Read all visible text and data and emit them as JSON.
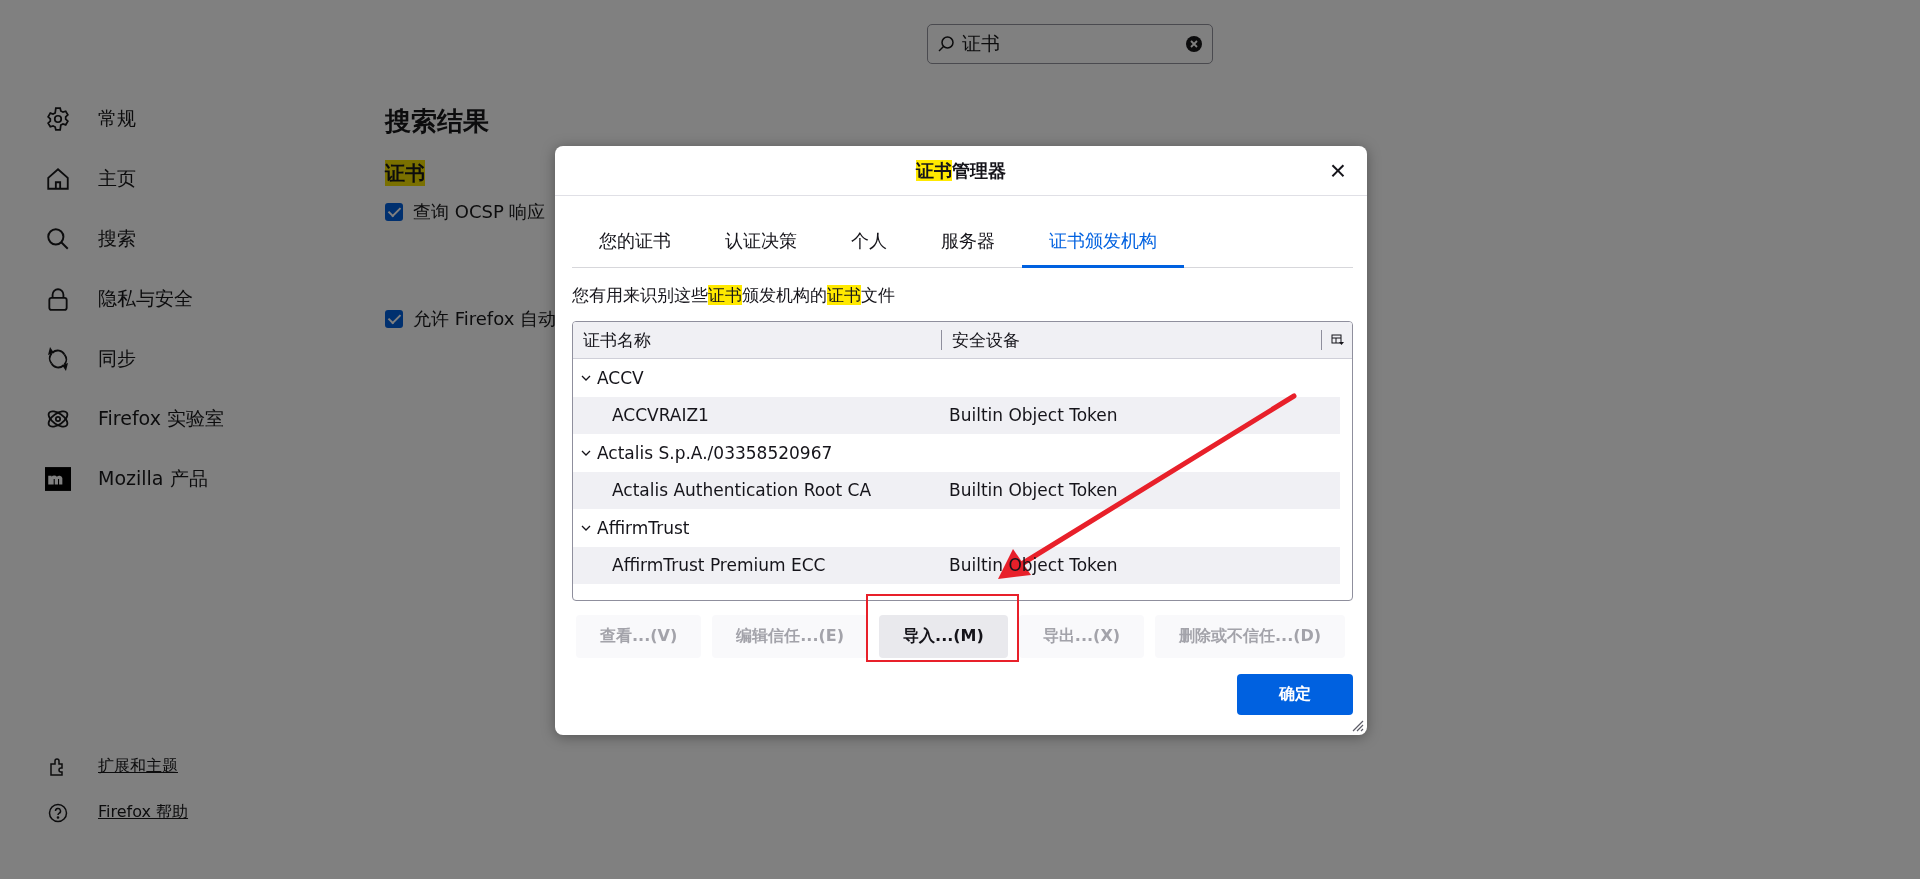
{
  "sidebar": {
    "items": [
      {
        "label": "常规",
        "selected": false
      },
      {
        "label": "主页",
        "selected": false
      },
      {
        "label": "搜索",
        "selected": false
      },
      {
        "label": "隐私与安全",
        "selected": false
      },
      {
        "label": "同步",
        "selected": false
      },
      {
        "label": "Firefox 实验室",
        "selected": false
      },
      {
        "label": "Mozilla 产品",
        "selected": false
      }
    ],
    "footer_links": [
      "扩展和主题",
      "Firefox 帮助"
    ]
  },
  "search": {
    "value": "证书"
  },
  "results": {
    "heading": "搜索结果",
    "section": "证书",
    "options": [
      {
        "label": "查询 OCSP 响应",
        "checked": true
      },
      {
        "label": "允许 Firefox 自动",
        "checked": true
      }
    ]
  },
  "dialog": {
    "title": [
      {
        "text": "证书",
        "highlight": true
      },
      {
        "text": "管理器",
        "highlight": false
      }
    ],
    "close": "×",
    "tabs": [
      {
        "label": "您的证书",
        "selected": false
      },
      {
        "label": "认证决策",
        "selected": false
      },
      {
        "label": "个人",
        "selected": false
      },
      {
        "label": "服务器",
        "selected": false
      },
      {
        "label": "证书颁发机构",
        "selected": true
      }
    ],
    "description": [
      {
        "text": "您有用来识别这些",
        "highlight": false
      },
      {
        "text": "证书",
        "highlight": true
      },
      {
        "text": "颁发机构的",
        "highlight": false
      },
      {
        "text": "证书",
        "highlight": true
      },
      {
        "text": "文件",
        "highlight": false
      }
    ],
    "table": {
      "columns": [
        "证书名称",
        "安全设备"
      ],
      "rows": [
        {
          "name": "ACCV",
          "expanded": true,
          "children": [
            {
              "name": "ACCVRAIZ1",
              "device": "Builtin Object Token"
            }
          ]
        },
        {
          "name": "Actalis S.p.A./03358520967",
          "expanded": true,
          "children": [
            {
              "name": "Actalis Authentication Root CA",
              "device": "Builtin Object Token"
            }
          ]
        },
        {
          "name": "AffirmTrust",
          "expanded": true,
          "children": [
            {
              "name": "AffirmTrust Premium ECC",
              "device": "Builtin Object Token"
            }
          ]
        }
      ]
    },
    "buttons": [
      {
        "label": "查看...(V)",
        "disabled": true
      },
      {
        "label": "编辑信任...(E)",
        "disabled": true
      },
      {
        "label": "导入...(M)",
        "disabled": false
      },
      {
        "label": "导出...(X)",
        "disabled": true
      },
      {
        "label": "删除或不信任...(D)",
        "disabled": true
      }
    ],
    "ok_button": "确定"
  }
}
